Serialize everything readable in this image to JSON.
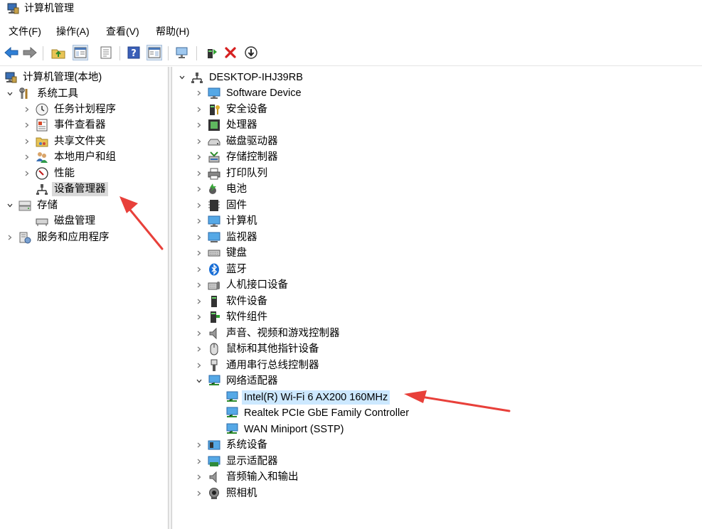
{
  "window": {
    "title": "计算机管理"
  },
  "menu": [
    "文件(F)",
    "操作(A)",
    "查看(V)",
    "帮助(H)"
  ],
  "toolbar": {
    "icons": [
      "back-arrow-icon",
      "forward-arrow-icon",
      "up-folder-icon",
      "show-hide-tree-icon",
      "properties-icon",
      "help-icon",
      "view-pane-icon",
      "scan-hardware-icon",
      "update-driver-icon",
      "uninstall-icon",
      "disable-device-icon"
    ]
  },
  "left_tree": {
    "root": "计算机管理(本地)",
    "system_tools": "系统工具",
    "task_scheduler": "任务计划程序",
    "event_viewer": "事件查看器",
    "shared_folders": "共享文件夹",
    "local_users": "本地用户和组",
    "performance": "性能",
    "device_manager": "设备管理器",
    "storage": "存储",
    "disk_management": "磁盘管理",
    "services_apps": "服务和应用程序"
  },
  "right_tree": {
    "root": "DESKTOP-IHJ39RB",
    "categories": [
      "Software Device",
      "安全设备",
      "处理器",
      "磁盘驱动器",
      "存储控制器",
      "打印队列",
      "电池",
      "固件",
      "计算机",
      "监视器",
      "键盘",
      "蓝牙",
      "人机接口设备",
      "软件设备",
      "软件组件",
      "声音、视频和游戏控制器",
      "鼠标和其他指针设备",
      "通用串行总线控制器",
      "网络适配器"
    ],
    "network_adapters": [
      "Intel(R) Wi-Fi 6 AX200 160MHz",
      "Realtek PCIe GbE Family Controller",
      "WAN Miniport (SSTP)"
    ],
    "after_categories": [
      "系统设备",
      "显示适配器",
      "音频输入和输出",
      "照相机"
    ]
  },
  "colors": {
    "selected_blue": "#cce8ff",
    "selected_gray": "#d9d9d9",
    "annotation_arrow": "#e8403a"
  }
}
